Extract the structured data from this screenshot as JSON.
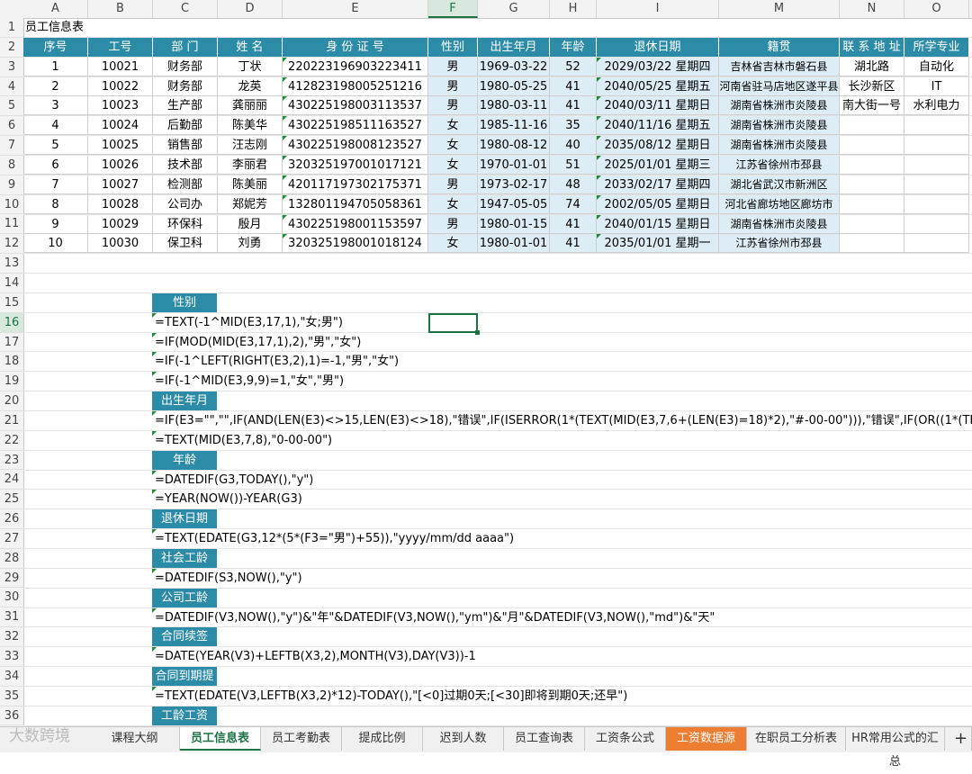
{
  "colors": {
    "header_bg": "#2c8ba6",
    "header_text": "#ffffff",
    "light_blue": "#dcedf5",
    "selection": "#1e7145",
    "orange_tab": "#ed7d31"
  },
  "columns": [
    "A",
    "B",
    "C",
    "D",
    "E",
    "F",
    "G",
    "H",
    "I",
    "M",
    "N",
    "O"
  ],
  "selected_column": "F",
  "rows": [
    "1",
    "2",
    "3",
    "4",
    "5",
    "6",
    "7",
    "8",
    "9",
    "10",
    "11",
    "12",
    "13",
    "14",
    "15",
    "16",
    "17",
    "18",
    "19",
    "20",
    "21",
    "22",
    "23",
    "24",
    "25",
    "26",
    "27",
    "28",
    "29",
    "30",
    "31",
    "32",
    "33",
    "34",
    "35",
    "36"
  ],
  "selected_row": "16",
  "title": "员工信息表",
  "table": {
    "headers": [
      "序号",
      "工号",
      "部  门",
      "姓  名",
      "身 份 证 号",
      "性别",
      "出生年月",
      "年龄",
      "退休日期",
      "籍贯",
      "联 系 地 址",
      "所学专业"
    ],
    "rows": [
      [
        "1",
        "10021",
        "财务部",
        "丁状",
        "220223196903223411",
        "男",
        "1969-03-22",
        "52",
        "2029/03/22 星期四",
        "吉林省吉林市磐石县",
        "湖北路",
        "自动化"
      ],
      [
        "2",
        "10022",
        "财务部",
        "龙英",
        "412823198005251216",
        "男",
        "1980-05-25",
        "41",
        "2040/05/25 星期五",
        "河南省驻马店地区遂平县",
        "长沙新区",
        "IT"
      ],
      [
        "3",
        "10023",
        "生产部",
        "龚丽丽",
        "430225198003113537",
        "男",
        "1980-03-11",
        "41",
        "2040/03/11 星期日",
        "湖南省株洲市炎陵县",
        "南大街一号",
        "水利电力"
      ],
      [
        "4",
        "10024",
        "后勤部",
        "陈美华",
        "430225198511163527",
        "女",
        "1985-11-16",
        "35",
        "2040/11/16 星期五",
        "湖南省株洲市炎陵县",
        "",
        ""
      ],
      [
        "5",
        "10025",
        "销售部",
        "汪志刚",
        "430225198008123527",
        "女",
        "1980-08-12",
        "40",
        "2035/08/12 星期日",
        "湖南省株洲市炎陵县",
        "",
        ""
      ],
      [
        "6",
        "10026",
        "技术部",
        "李丽君",
        "320325197001017121",
        "女",
        "1970-01-01",
        "51",
        "2025/01/01 星期三",
        "江苏省徐州市邳县",
        "",
        ""
      ],
      [
        "7",
        "10027",
        "检测部",
        "陈美丽",
        "420117197302175371",
        "男",
        "1973-02-17",
        "48",
        "2033/02/17 星期四",
        "湖北省武汉市新洲区",
        "",
        ""
      ],
      [
        "8",
        "10028",
        "公司办",
        "郑妮芳",
        "132801194705058361",
        "女",
        "1947-05-05",
        "74",
        "2002/05/05 星期日",
        "河北省廊坊地区廊坊市",
        "",
        ""
      ],
      [
        "9",
        "10029",
        "环保科",
        "殷月",
        "430225198001153597",
        "男",
        "1980-01-15",
        "41",
        "2040/01/15 星期日",
        "湖南省株洲市炎陵县",
        "",
        ""
      ],
      [
        "10",
        "10030",
        "保卫科",
        "刘勇",
        "320325198001018124",
        "女",
        "1980-01-01",
        "41",
        "2035/01/01 星期一",
        "江苏省徐州市邳县",
        "",
        ""
      ]
    ]
  },
  "sections": [
    {
      "label": "性别"
    },
    {
      "label": "出生年月"
    },
    {
      "label": "年龄"
    },
    {
      "label": "退休日期"
    },
    {
      "label": "社会工龄"
    },
    {
      "label": "公司工龄"
    },
    {
      "label": "合同续签"
    },
    {
      "label": "合同到期提醒"
    },
    {
      "label": "工龄工资"
    }
  ],
  "formulas": [
    "=TEXT(-1^MID(E3,17,1),\"女;男\")",
    "=IF(MOD(MID(E3,17,1),2),\"男\",\"女\")",
    "=IF(-1^LEFT(RIGHT(E3,2),1)=-1,\"男\",\"女\")",
    "=IF(-1^MID(E3,9,9)=1,\"女\",\"男\")",
    "=IF(E3=\"\",\"\",IF(AND(LEN(E3)<>15,LEN(E3)<>18),\"错误\",IF(ISERROR(1*(TEXT(MID(E3,7,6+(LEN(E3)=18)*2),\"#-00-00\"))),\"错误\",IF(OR((1*(TEXT(MID(E3",
    "=TEXT(MID(E3,7,8),\"0-00-00\")",
    "=DATEDIF(G3,TODAY(),\"y\")",
    "=YEAR(NOW())-YEAR(G3)",
    "=TEXT(EDATE(G3,12*(5*(F3=\"男\")+55)),\"yyyy/mm/dd aaaa\")",
    "=DATEDIF(S3,NOW(),\"y\")",
    "=DATEDIF(V3,NOW(),\"y\")&\"年\"&DATEDIF(V3,NOW(),\"ym\")&\"月\"&DATEDIF(V3,NOW(),\"md\")&\"天\"",
    "=DATE(YEAR(V3)+LEFTB(X3,2),MONTH(V3),DAY(V3))-1",
    "=TEXT(EDATE(V3,LEFTB(X3,2)*12)-TODAY(),\"[<0]过期0天;[<30]即将到期0天;还早\")"
  ],
  "tabs": [
    {
      "label": "课程大纲",
      "state": ""
    },
    {
      "label": "员工信息表",
      "state": "active"
    },
    {
      "label": "员工考勤表",
      "state": ""
    },
    {
      "label": "提成比例",
      "state": ""
    },
    {
      "label": "迟到人数",
      "state": ""
    },
    {
      "label": "员工查询表",
      "state": ""
    },
    {
      "label": "工资条公式",
      "state": ""
    },
    {
      "label": "工资数据源",
      "state": "orange"
    },
    {
      "label": "在职员工分析表",
      "state": ""
    },
    {
      "label": "HR常用公式的汇总",
      "state": ""
    }
  ],
  "add_tab_symbol": "+",
  "watermark": "大数跨境"
}
